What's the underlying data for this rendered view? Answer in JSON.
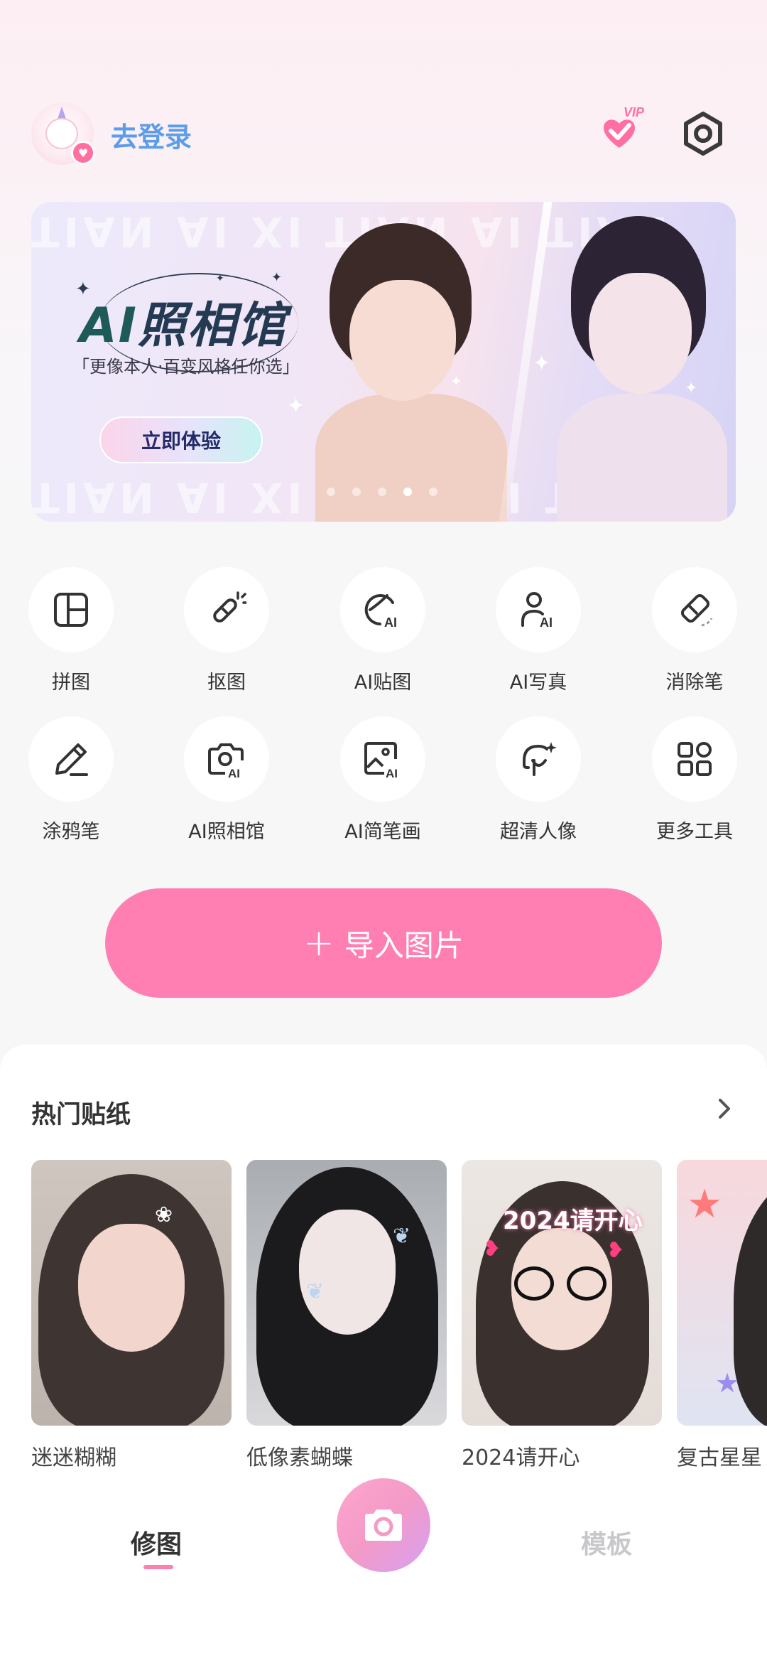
{
  "header": {
    "login_text": "去登录",
    "vip_badge": "VIP"
  },
  "banner": {
    "title_ai": "AI",
    "title_rest": "照相馆",
    "subtitle": "「更像本人·百变风格任你选」",
    "cta_label": "立即体验",
    "watermark": "TIAN AI XI TIAN AI TIAN",
    "active_slide": 3,
    "slide_count": 5
  },
  "tools": [
    {
      "label": "拼图",
      "icon": "collage-icon"
    },
    {
      "label": "抠图",
      "icon": "cutout-wand-icon"
    },
    {
      "label": "AI贴图",
      "icon": "ai-sticker-icon"
    },
    {
      "label": "AI写真",
      "icon": "ai-portrait-icon"
    },
    {
      "label": "消除笔",
      "icon": "eraser-icon"
    },
    {
      "label": "涂鸦笔",
      "icon": "pencil-icon"
    },
    {
      "label": "AI照相馆",
      "icon": "ai-camera-icon"
    },
    {
      "label": "AI简笔画",
      "icon": "ai-sketch-icon"
    },
    {
      "label": "超清人像",
      "icon": "hd-portrait-icon"
    },
    {
      "label": "更多工具",
      "icon": "more-tools-grid-icon"
    }
  ],
  "import_button": {
    "label": "导入图片",
    "icon": "plus-icon"
  },
  "stickers_section": {
    "title": "热门贴纸",
    "items": [
      {
        "label": "迷迷糊糊"
      },
      {
        "label": "低像素蝴蝶"
      },
      {
        "label": "2024请开心",
        "overlay_text": "2024请开心"
      },
      {
        "label": "复古星星"
      }
    ]
  },
  "bottom_nav": {
    "left_tab": "修图",
    "right_tab": "模板",
    "center_icon": "camera-icon"
  },
  "colors": {
    "accent_pink": "#ff7fb2",
    "login_blue": "#5b9de8",
    "inactive_tab": "#c8c8cc"
  }
}
